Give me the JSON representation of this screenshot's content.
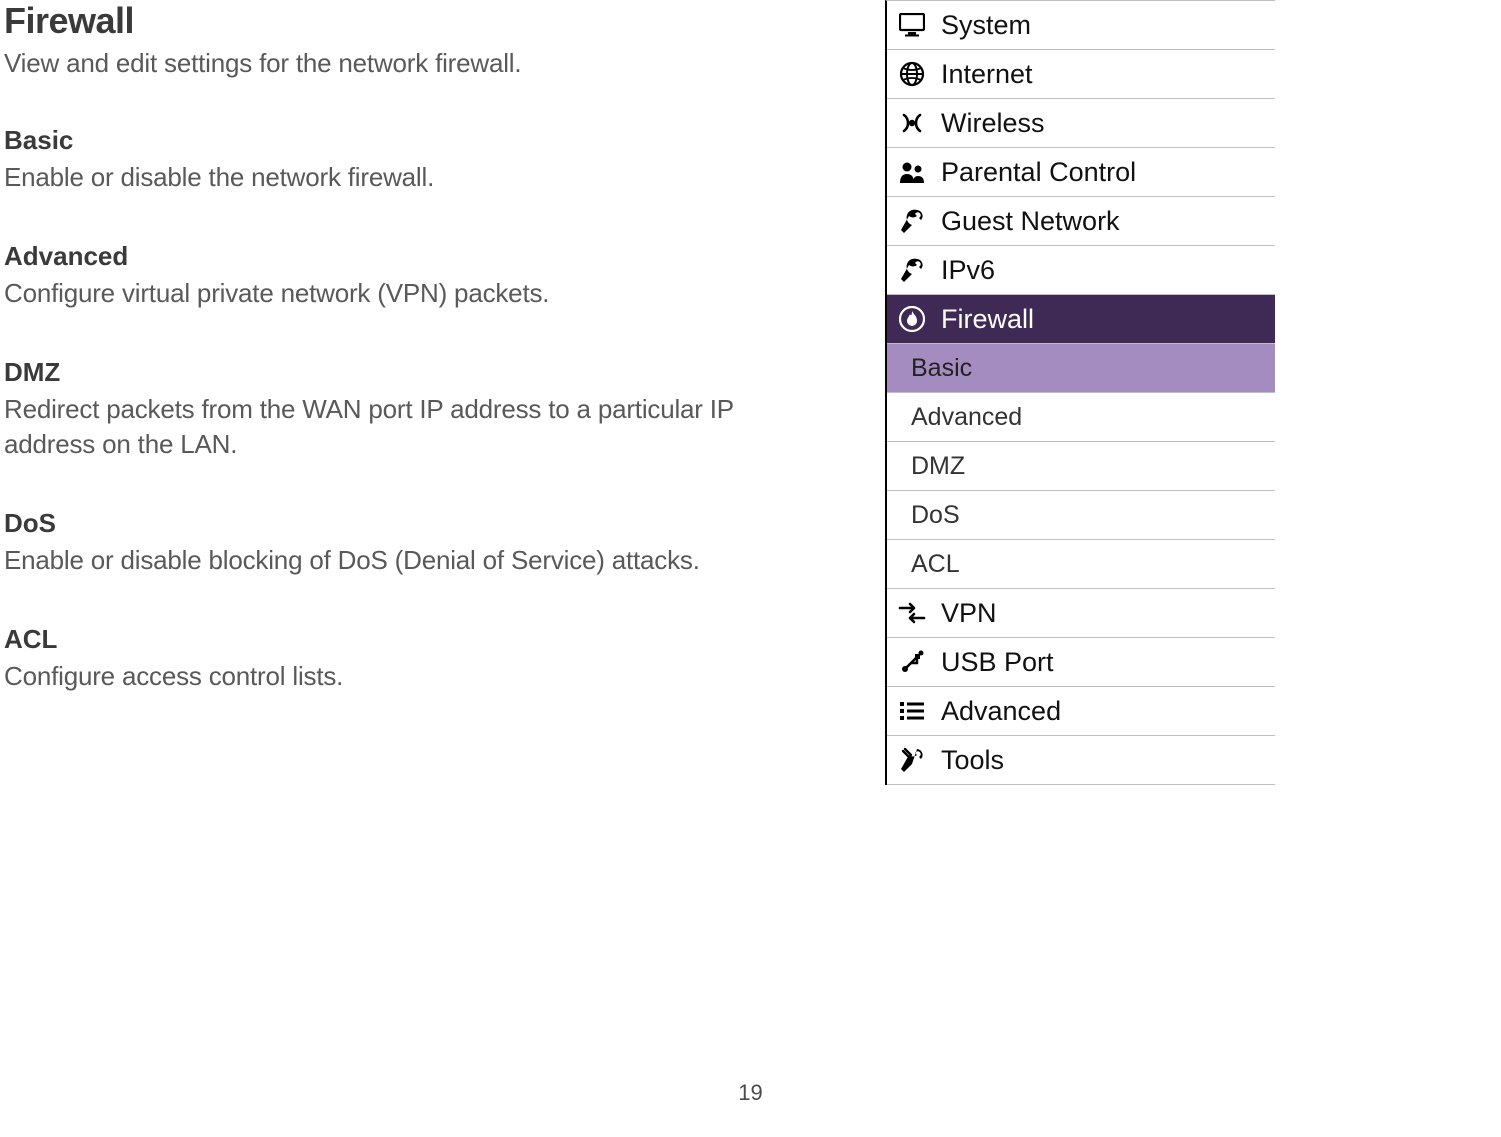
{
  "doc": {
    "title": "Firewall",
    "lead": "View and edit settings for the network firewall.",
    "sections": [
      {
        "heading": "Basic",
        "desc": "Enable or disable the network firewall."
      },
      {
        "heading": "Advanced",
        "desc": "Configure virtual private network (VPN) packets."
      },
      {
        "heading": "DMZ",
        "desc": "Redirect packets from the WAN port IP address to a particular IP address on the LAN."
      },
      {
        "heading": "DoS",
        "desc": "Enable or disable blocking of DoS (Denial of Service) attacks."
      },
      {
        "heading": "ACL",
        "desc": "Configure access control lists."
      }
    ],
    "page_number": "19"
  },
  "nav": {
    "items": [
      {
        "label": "System"
      },
      {
        "label": "Internet"
      },
      {
        "label": "Wireless"
      },
      {
        "label": "Parental Control"
      },
      {
        "label": "Guest Network"
      },
      {
        "label": "IPv6"
      },
      {
        "label": "Firewall"
      },
      {
        "label": "VPN"
      },
      {
        "label": "USB Port"
      },
      {
        "label": "Advanced"
      },
      {
        "label": "Tools"
      }
    ],
    "firewall_sub": [
      {
        "label": "Basic"
      },
      {
        "label": "Advanced"
      },
      {
        "label": "DMZ"
      },
      {
        "label": "DoS"
      },
      {
        "label": "ACL"
      }
    ]
  }
}
